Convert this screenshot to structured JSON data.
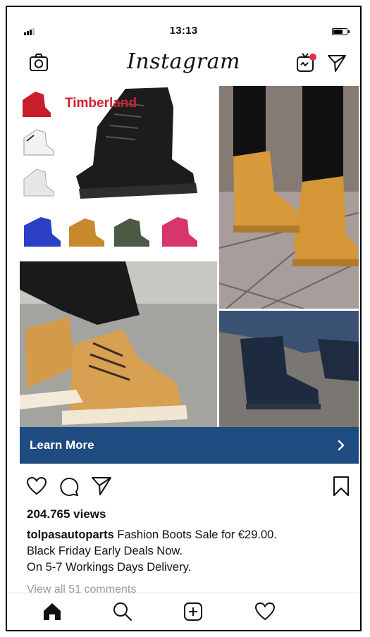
{
  "status_bar": {
    "time": "13:13"
  },
  "header": {
    "logo": "Instagram",
    "icons": [
      "camera-icon",
      "igtv-icon",
      "direct-message-icon"
    ]
  },
  "post": {
    "brand_overlay": "Timberland",
    "cta_label": "Learn More",
    "views": "204.765 views",
    "username": "tolpasautoparts",
    "caption_line1": "Fashion Boots Sale for €29.00.",
    "caption_line2": "Black Friday Early Deals Now.",
    "caption_line3": "On 5-7 Workings Days Delivery.",
    "comments_link": "View all 51 comments",
    "action_icons": [
      "heart-icon",
      "comment-icon",
      "share-icon",
      "bookmark-icon"
    ]
  },
  "colors": {
    "cta_background": "#1e4b80",
    "brand_red": "#d1202f",
    "notification_dot": "#e8313f",
    "muted_text": "#9a9a9a"
  },
  "bottom_nav": {
    "icons": [
      "home-icon",
      "search-icon",
      "add-post-icon",
      "activity-heart-icon"
    ]
  }
}
